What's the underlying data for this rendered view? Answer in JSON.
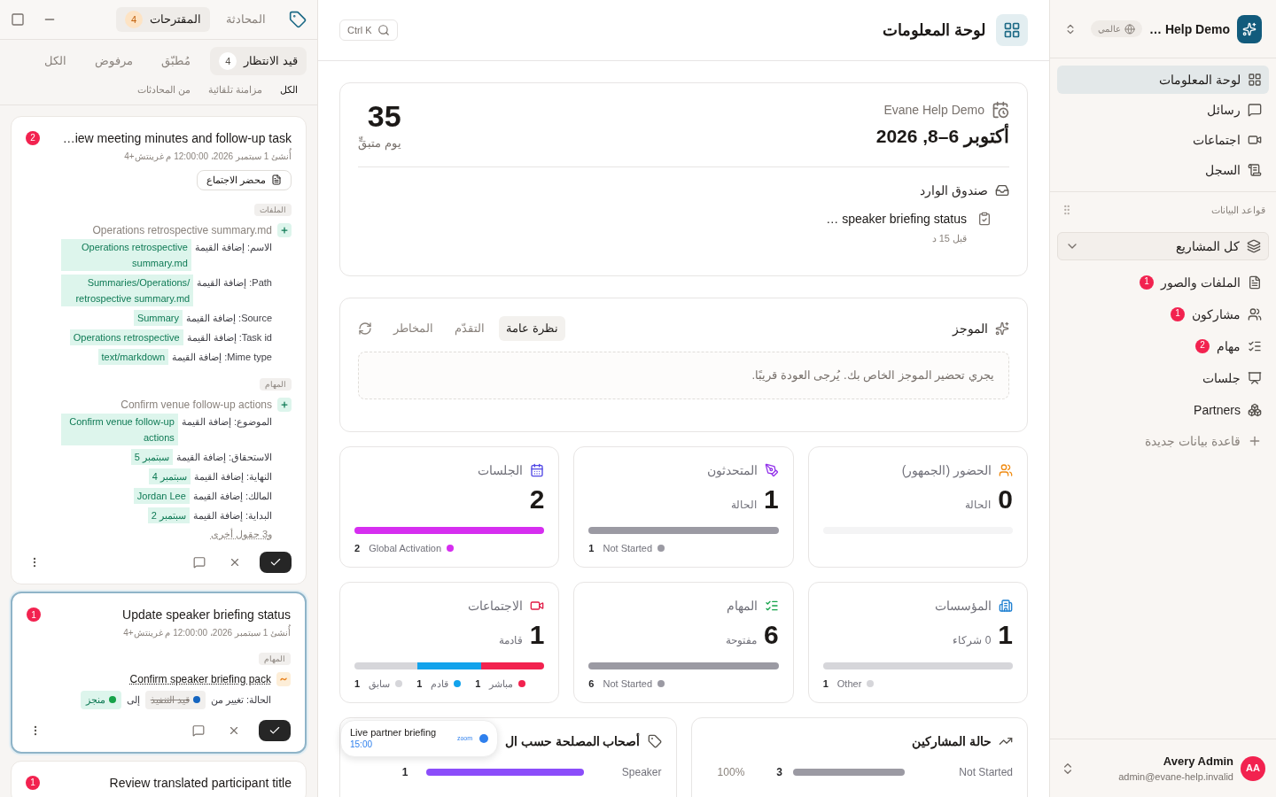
{
  "sidebar": {
    "workspace": {
      "name": "… Help Demo",
      "scope": "عالمي"
    },
    "nav": [
      {
        "label": "لوحة المعلومات",
        "selected": true
      },
      {
        "label": "رسائل",
        "selected": false
      },
      {
        "label": "اجتماعات",
        "selected": false
      },
      {
        "label": "السجل",
        "selected": false
      }
    ],
    "section_title": "قواعد البيانات",
    "project_filter": "كل المشاريع",
    "databases": [
      {
        "label": "الملفات والصور",
        "badge": "1"
      },
      {
        "label": "مشاركون",
        "badge": "1"
      },
      {
        "label": "مهام",
        "badge": "2"
      },
      {
        "label": "جلسات"
      },
      {
        "label": "Partners"
      }
    ],
    "add_database": "قاعدة بيانات جديدة",
    "user": {
      "initials": "AA",
      "name": "Avery Admin",
      "email": "admin@evane-help.invalid"
    }
  },
  "header": {
    "title": "لوحة المعلومات",
    "search_shortcut": "Ctrl K"
  },
  "event": {
    "name": "Evane Help Demo",
    "dates": "أكتوبر 6–8, 2026",
    "countdown": "35",
    "countdown_label": "يوم متبقٍّ",
    "inbox_title": "صندوق الوارد",
    "inbox": [
      {
        "title": "… speaker briefing status",
        "time": "قبل 15 د"
      }
    ]
  },
  "brief": {
    "title": "الموجز",
    "tabs": [
      {
        "label": "نظرة عامة",
        "selected": true
      },
      {
        "label": "التقدّم",
        "selected": false
      },
      {
        "label": "المخاطر",
        "selected": false
      }
    ],
    "message": "يجري تحضير الموجز الخاص بك. يُرجى العودة قريبًا."
  },
  "stats": [
    {
      "title": "الحضور (الجمهور)",
      "value": "0",
      "sublabel": "الحالة"
    },
    {
      "title": "المتحدثون",
      "value": "1",
      "sublabel": "الحالة",
      "segments": [
        {
          "color": "#9b9aa3"
        }
      ],
      "legend": [
        {
          "label": "Not Started",
          "count": "1",
          "color": "#9b9aa3"
        }
      ]
    },
    {
      "title": "الجلسات",
      "value": "2",
      "segments": [
        {
          "color": "#d62ef0"
        }
      ],
      "legend": [
        {
          "label": "Global Activation",
          "count": "2",
          "color": "#d62ef0"
        }
      ]
    },
    {
      "title": "المؤسسات",
      "value": "1",
      "sublabel": "0 شركاء",
      "segments": [
        {
          "color": "#d6d6da"
        }
      ],
      "legend": [
        {
          "label": "Other",
          "count": "1",
          "color": "#d6d6da"
        }
      ]
    },
    {
      "title": "المهام",
      "value": "6",
      "sublabel": "مفتوحة",
      "segments": [
        {
          "color": "#9b9aa3"
        }
      ],
      "legend": [
        {
          "label": "Not Started",
          "count": "6",
          "color": "#9b9aa3"
        }
      ]
    },
    {
      "title": "الاجتماعات",
      "value": "1",
      "sublabel": "قادمة",
      "segments": [
        {
          "color": "#f2224f"
        },
        {
          "color": "#12a3ec"
        },
        {
          "color": "#d6d6da"
        }
      ],
      "legend": [
        {
          "label": "مباشر",
          "count": "1",
          "color": "#f2224f"
        },
        {
          "label": "قادم",
          "count": "1",
          "color": "#12a3ec"
        },
        {
          "label": "سابق",
          "count": "1",
          "color": "#d6d6da"
        }
      ]
    }
  ],
  "participant_status": {
    "title": "حالة المشاركين",
    "rows": [
      {
        "label": "Not Started",
        "count": "3",
        "percent": "100%"
      }
    ]
  },
  "stakeholders": {
    "title": "أصحاب المصلحة حسب ال",
    "rows": [
      {
        "label": "Speaker",
        "count": "1"
      }
    ]
  },
  "live_popup": {
    "title": "Live partner briefing",
    "time": "15:00",
    "provider": "zoom"
  },
  "assistant": {
    "tabs": [
      {
        "label": "المحادثة",
        "selected": false
      },
      {
        "label": "المقترحات",
        "count": "4",
        "selected": true
      }
    ],
    "status_filters": [
      {
        "label": "قيد الانتظار",
        "count": "4",
        "selected": true
      },
      {
        "label": "مُطبّق",
        "selected": false
      },
      {
        "label": "مرفوض",
        "selected": false
      },
      {
        "label": "الكل",
        "selected": false
      }
    ],
    "source_filters": [
      {
        "label": "الكل",
        "selected": true
      },
      {
        "label": "مزامنة تلقائية",
        "selected": false
      },
      {
        "label": "من المحادثات",
        "selected": false
      }
    ],
    "suggestions": [
      {
        "badge": "2",
        "title": "…iew meeting minutes and follow-up task",
        "created": "أُنشئ 1 سبتمبر 2026، 12:00:00 م غرينتش+4",
        "source_button": "محضر الاجتماع",
        "selected": false,
        "groups": [
          {
            "title": "الملفات",
            "items": [
              {
                "kind": "add",
                "name": "Operations retrospective summary.md",
                "fields": [
                  {
                    "label": "الاسم: إضافة القيمة",
                    "value": "Operations retrospective summary.md"
                  },
                  {
                    "label": "Path: إضافة القيمة",
                    "value": "/Summaries/Operations retrospective summary.md"
                  },
                  {
                    "label": "Source: إضافة القيمة",
                    "value": "Summary"
                  },
                  {
                    "label": "Task id: إضافة القيمة",
                    "value": "Operations retrospective"
                  },
                  {
                    "label": "Mime type: إضافة القيمة",
                    "value": "text/markdown"
                  }
                ]
              }
            ]
          },
          {
            "title": "المهام",
            "items": [
              {
                "kind": "add",
                "name": "Confirm venue follow-up actions",
                "fields": [
                  {
                    "label": "الموضوع: إضافة القيمة",
                    "value": "Confirm venue follow-up actions"
                  },
                  {
                    "label": "الاستحقاق: إضافة القيمة",
                    "value": "سبتمبر 5"
                  },
                  {
                    "label": "النهاية: إضافة القيمة",
                    "value": "سبتمبر 4"
                  },
                  {
                    "label": "المالك: إضافة القيمة",
                    "value": "Jordan Lee"
                  },
                  {
                    "label": "البداية: إضافة القيمة",
                    "value": "سبتمبر 2"
                  }
                ],
                "more": "و3 حقول أخرى"
              }
            ]
          }
        ]
      },
      {
        "badge": "1",
        "title": "Update speaker briefing status",
        "created": "أُنشئ 1 سبتمبر 2026، 12:00:00 م غرينتش+4",
        "selected": true,
        "groups": [
          {
            "title": "المهام",
            "items": [
              {
                "kind": "update",
                "name": "Confirm speaker briefing pack",
                "change_label": "الحالة: تغيير من",
                "from": {
                  "label": "قيد التنفيذ",
                  "color": "#1565c0"
                },
                "to_word": "إلى",
                "to": {
                  "label": "منجز",
                  "color": "#16a34a"
                }
              }
            ]
          }
        ]
      },
      {
        "badge": "1",
        "title": "Review translated participant title"
      }
    ]
  }
}
